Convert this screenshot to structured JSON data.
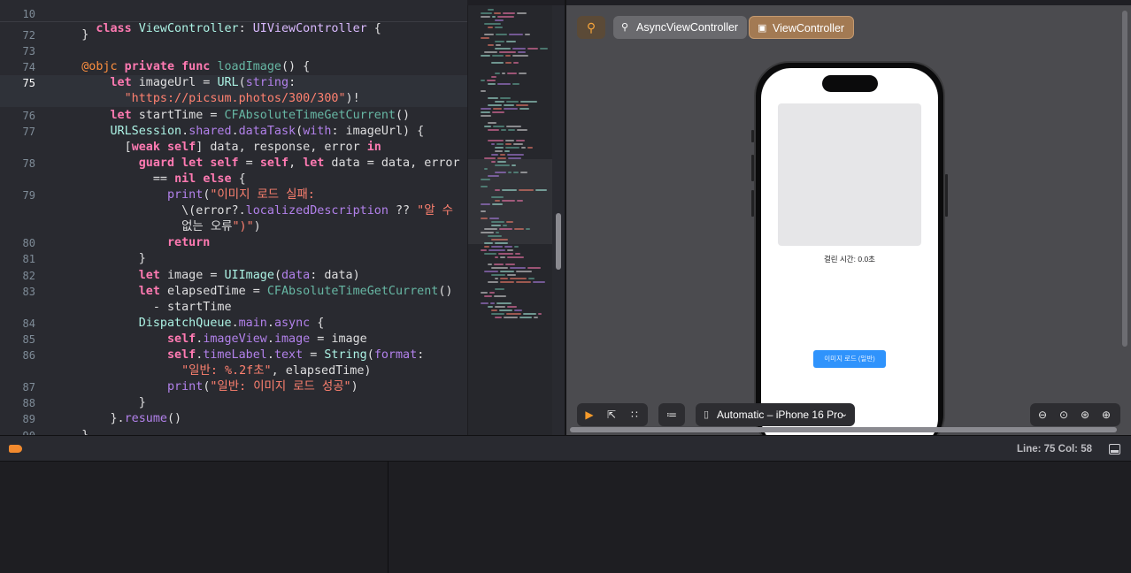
{
  "editor": {
    "sticky_header": {
      "line_number": "10",
      "text": "class ViewController: UIViewController {"
    },
    "current_line": "75",
    "lines": [
      {
        "n": "72",
        "text": "    }"
      },
      {
        "n": "73",
        "text": ""
      },
      {
        "n": "74",
        "text": "    @objc private func loadImage() {"
      },
      {
        "n": "75",
        "text": "        let imageUrl = URL(string:"
      },
      {
        "n": "",
        "text": "          \"https://picsum.photos/300/300\")!"
      },
      {
        "n": "76",
        "text": "        let startTime = CFAbsoluteTimeGetCurrent()"
      },
      {
        "n": "77",
        "text": "        URLSession.shared.dataTask(with: imageUrl) {"
      },
      {
        "n": "",
        "text": "          [weak self] data, response, error in"
      },
      {
        "n": "78",
        "text": "            guard let self = self, let data = data, error"
      },
      {
        "n": "",
        "text": "              == nil else {"
      },
      {
        "n": "79",
        "text": "                print(\"이미지 로드 실패:"
      },
      {
        "n": "",
        "text": "                  \\(error?.localizedDescription ?? \"알 수"
      },
      {
        "n": "",
        "text": "                  없는 오류\")\")"
      },
      {
        "n": "80",
        "text": "                return"
      },
      {
        "n": "81",
        "text": "            }"
      },
      {
        "n": "82",
        "text": "            let image = UIImage(data: data)"
      },
      {
        "n": "83",
        "text": "            let elapsedTime = CFAbsoluteTimeGetCurrent()"
      },
      {
        "n": "",
        "text": "              - startTime"
      },
      {
        "n": "84",
        "text": "            DispatchQueue.main.async {"
      },
      {
        "n": "85",
        "text": "                self.imageView.image = image"
      },
      {
        "n": "86",
        "text": "                self.timeLabel.text = String(format:"
      },
      {
        "n": "",
        "text": "                  \"일반: %.2f초\", elapsedTime)"
      },
      {
        "n": "87",
        "text": "                print(\"일반: 이미지 로드 성공\")"
      },
      {
        "n": "88",
        "text": "            }"
      },
      {
        "n": "89",
        "text": "        }.resume()"
      },
      {
        "n": "90",
        "text": "    }"
      }
    ]
  },
  "canvas": {
    "pin_icon": "pin-icon",
    "previews": [
      {
        "label": "AsyncViewController",
        "icon": "pin-icon",
        "selected": false
      },
      {
        "label": "ViewController",
        "icon": "window-icon",
        "selected": true
      }
    ],
    "phone": {
      "time_label": "걸린 시간: 0.0초",
      "load_button": "이미지 로드 (일반)"
    },
    "bottom": {
      "device_label": "Automatic – iPhone 16 Pro",
      "zoom_icons": [
        "zoom-out-icon",
        "zoom-fit-icon",
        "zoom-to-100-icon",
        "zoom-in-icon"
      ]
    }
  },
  "status": {
    "line_col": "Line: 75  Col: 58"
  },
  "colors": {
    "editor_bg": "#292a30",
    "keyword": "#ff7ab2",
    "string": "#ff8170",
    "accent_orange": "#f28a2e",
    "preview_button": "#2f93fc"
  }
}
